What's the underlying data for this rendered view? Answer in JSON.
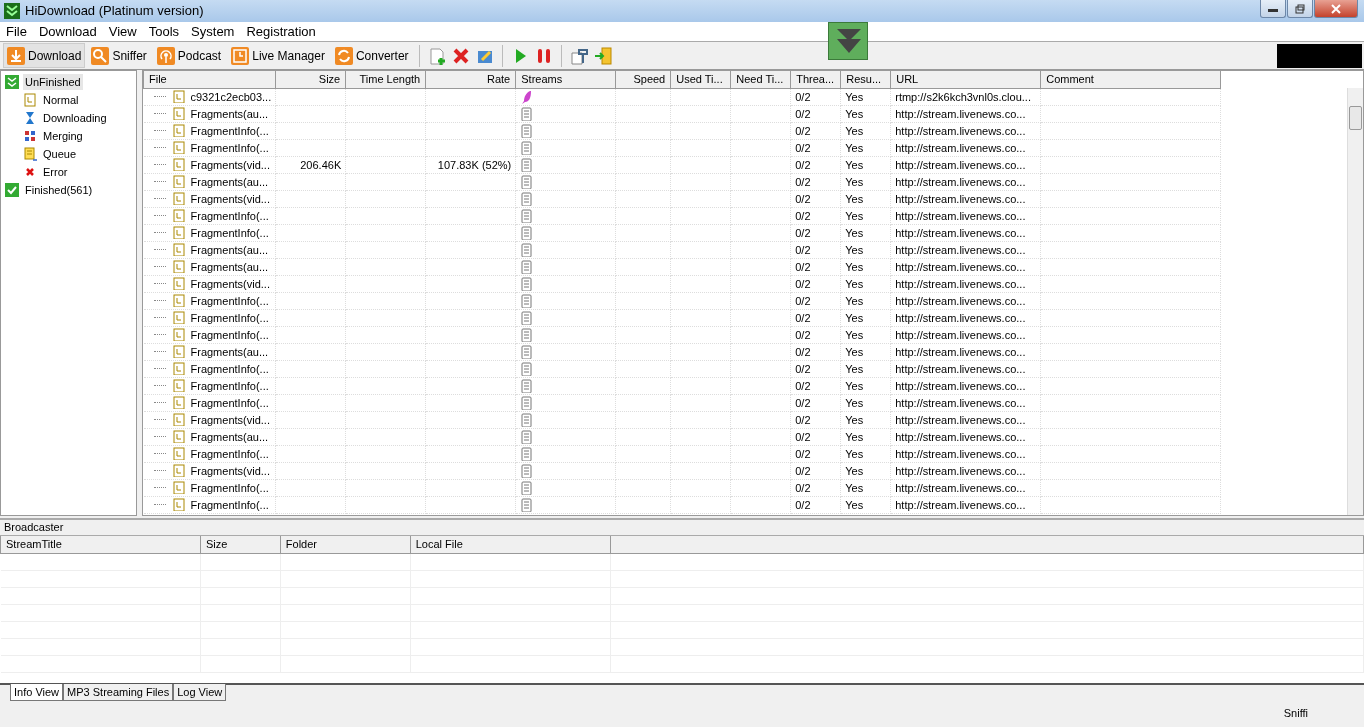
{
  "window": {
    "title": "HiDownload (Platinum version)"
  },
  "menu": [
    "File",
    "Download",
    "View",
    "Tools",
    "System",
    "Registration"
  ],
  "tabs": [
    {
      "label": "Download",
      "selected": true,
      "kind": "download"
    },
    {
      "label": "Sniffer",
      "selected": false,
      "kind": "sniffer"
    },
    {
      "label": "Podcast",
      "selected": false,
      "kind": "podcast"
    },
    {
      "label": "Live Manager",
      "selected": false,
      "kind": "live"
    },
    {
      "label": "Converter",
      "selected": false,
      "kind": "convert"
    }
  ],
  "sidebar": {
    "items": [
      {
        "label": "UnFinished",
        "selected": true,
        "kind": "unfinished",
        "children": [
          {
            "label": "Normal",
            "selected": false,
            "kind": "normal"
          },
          {
            "label": "Downloading",
            "selected": false,
            "kind": "downloading"
          },
          {
            "label": "Merging",
            "selected": false,
            "kind": "merging"
          },
          {
            "label": "Queue",
            "selected": false,
            "kind": "queue"
          },
          {
            "label": "Error",
            "selected": false,
            "kind": "error"
          }
        ]
      },
      {
        "label": "Finished(561)",
        "selected": false,
        "kind": "finished"
      }
    ]
  },
  "table": {
    "columns": [
      {
        "label": "File",
        "kind": "left"
      },
      {
        "label": "Size",
        "kind": "right"
      },
      {
        "label": "Time Length",
        "kind": "right"
      },
      {
        "label": "Rate",
        "kind": "right"
      },
      {
        "label": "Streams",
        "kind": "left"
      },
      {
        "label": "Speed",
        "kind": "right"
      },
      {
        "label": "Used Ti...",
        "kind": "left"
      },
      {
        "label": "Need Ti...",
        "kind": "left"
      },
      {
        "label": "Threa...",
        "kind": "left"
      },
      {
        "label": "Resu...",
        "kind": "left"
      },
      {
        "label": "URL",
        "kind": "left"
      },
      {
        "label": "Comment",
        "kind": "left"
      }
    ],
    "rows": [
      {
        "file": "c9321c2ecb03...",
        "size": "",
        "rate": "",
        "kind": "feather",
        "threads": "0/2",
        "resume": "Yes",
        "url": "rtmp://s2k6kch3vnl0s.clou..."
      },
      {
        "file": "Fragments(au...",
        "size": "",
        "rate": "",
        "kind": "document",
        "threads": "0/2",
        "resume": "Yes",
        "url": "http://stream.livenews.co..."
      },
      {
        "file": "FragmentInfo(...",
        "size": "",
        "rate": "",
        "kind": "document",
        "threads": "0/2",
        "resume": "Yes",
        "url": "http://stream.livenews.co..."
      },
      {
        "file": "FragmentInfo(...",
        "size": "",
        "rate": "",
        "kind": "document",
        "threads": "0/2",
        "resume": "Yes",
        "url": "http://stream.livenews.co..."
      },
      {
        "file": "Fragments(vid...",
        "size": "206.46K",
        "rate": "107.83K (52%)",
        "kind": "document",
        "threads": "0/2",
        "resume": "Yes",
        "url": "http://stream.livenews.co..."
      },
      {
        "file": "Fragments(au...",
        "size": "",
        "rate": "",
        "kind": "document",
        "threads": "0/2",
        "resume": "Yes",
        "url": "http://stream.livenews.co..."
      },
      {
        "file": "Fragments(vid...",
        "size": "",
        "rate": "",
        "kind": "document",
        "threads": "0/2",
        "resume": "Yes",
        "url": "http://stream.livenews.co..."
      },
      {
        "file": "FragmentInfo(...",
        "size": "",
        "rate": "",
        "kind": "document",
        "threads": "0/2",
        "resume": "Yes",
        "url": "http://stream.livenews.co..."
      },
      {
        "file": "FragmentInfo(...",
        "size": "",
        "rate": "",
        "kind": "document",
        "threads": "0/2",
        "resume": "Yes",
        "url": "http://stream.livenews.co..."
      },
      {
        "file": "Fragments(au...",
        "size": "",
        "rate": "",
        "kind": "document",
        "threads": "0/2",
        "resume": "Yes",
        "url": "http://stream.livenews.co..."
      },
      {
        "file": "Fragments(au...",
        "size": "",
        "rate": "",
        "kind": "document",
        "threads": "0/2",
        "resume": "Yes",
        "url": "http://stream.livenews.co..."
      },
      {
        "file": "Fragments(vid...",
        "size": "",
        "rate": "",
        "kind": "document",
        "threads": "0/2",
        "resume": "Yes",
        "url": "http://stream.livenews.co..."
      },
      {
        "file": "FragmentInfo(...",
        "size": "",
        "rate": "",
        "kind": "document",
        "threads": "0/2",
        "resume": "Yes",
        "url": "http://stream.livenews.co..."
      },
      {
        "file": "FragmentInfo(...",
        "size": "",
        "rate": "",
        "kind": "document",
        "threads": "0/2",
        "resume": "Yes",
        "url": "http://stream.livenews.co..."
      },
      {
        "file": "FragmentInfo(...",
        "size": "",
        "rate": "",
        "kind": "document",
        "threads": "0/2",
        "resume": "Yes",
        "url": "http://stream.livenews.co..."
      },
      {
        "file": "Fragments(au...",
        "size": "",
        "rate": "",
        "kind": "document",
        "threads": "0/2",
        "resume": "Yes",
        "url": "http://stream.livenews.co..."
      },
      {
        "file": "FragmentInfo(...",
        "size": "",
        "rate": "",
        "kind": "document",
        "threads": "0/2",
        "resume": "Yes",
        "url": "http://stream.livenews.co..."
      },
      {
        "file": "FragmentInfo(...",
        "size": "",
        "rate": "",
        "kind": "document",
        "threads": "0/2",
        "resume": "Yes",
        "url": "http://stream.livenews.co..."
      },
      {
        "file": "FragmentInfo(...",
        "size": "",
        "rate": "",
        "kind": "document",
        "threads": "0/2",
        "resume": "Yes",
        "url": "http://stream.livenews.co..."
      },
      {
        "file": "Fragments(vid...",
        "size": "",
        "rate": "",
        "kind": "document",
        "threads": "0/2",
        "resume": "Yes",
        "url": "http://stream.livenews.co..."
      },
      {
        "file": "Fragments(au...",
        "size": "",
        "rate": "",
        "kind": "document",
        "threads": "0/2",
        "resume": "Yes",
        "url": "http://stream.livenews.co..."
      },
      {
        "file": "FragmentInfo(...",
        "size": "",
        "rate": "",
        "kind": "document",
        "threads": "0/2",
        "resume": "Yes",
        "url": "http://stream.livenews.co..."
      },
      {
        "file": "Fragments(vid...",
        "size": "",
        "rate": "",
        "kind": "document",
        "threads": "0/2",
        "resume": "Yes",
        "url": "http://stream.livenews.co..."
      },
      {
        "file": "FragmentInfo(...",
        "size": "",
        "rate": "",
        "kind": "document",
        "threads": "0/2",
        "resume": "Yes",
        "url": "http://stream.livenews.co..."
      },
      {
        "file": "FragmentInfo(...",
        "size": "",
        "rate": "",
        "kind": "document",
        "threads": "0/2",
        "resume": "Yes",
        "url": "http://stream.livenews.co..."
      }
    ]
  },
  "broadcaster": {
    "title": "Broadcaster",
    "columns": [
      "StreamTitle",
      "Size",
      "Folder",
      "Local File"
    ]
  },
  "bottom_tabs": [
    {
      "label": "Info View",
      "selected": true
    },
    {
      "label": "MP3 Streaming Files",
      "selected": false
    },
    {
      "label": "Log View",
      "selected": false
    }
  ],
  "status_bar": "Sniffi"
}
